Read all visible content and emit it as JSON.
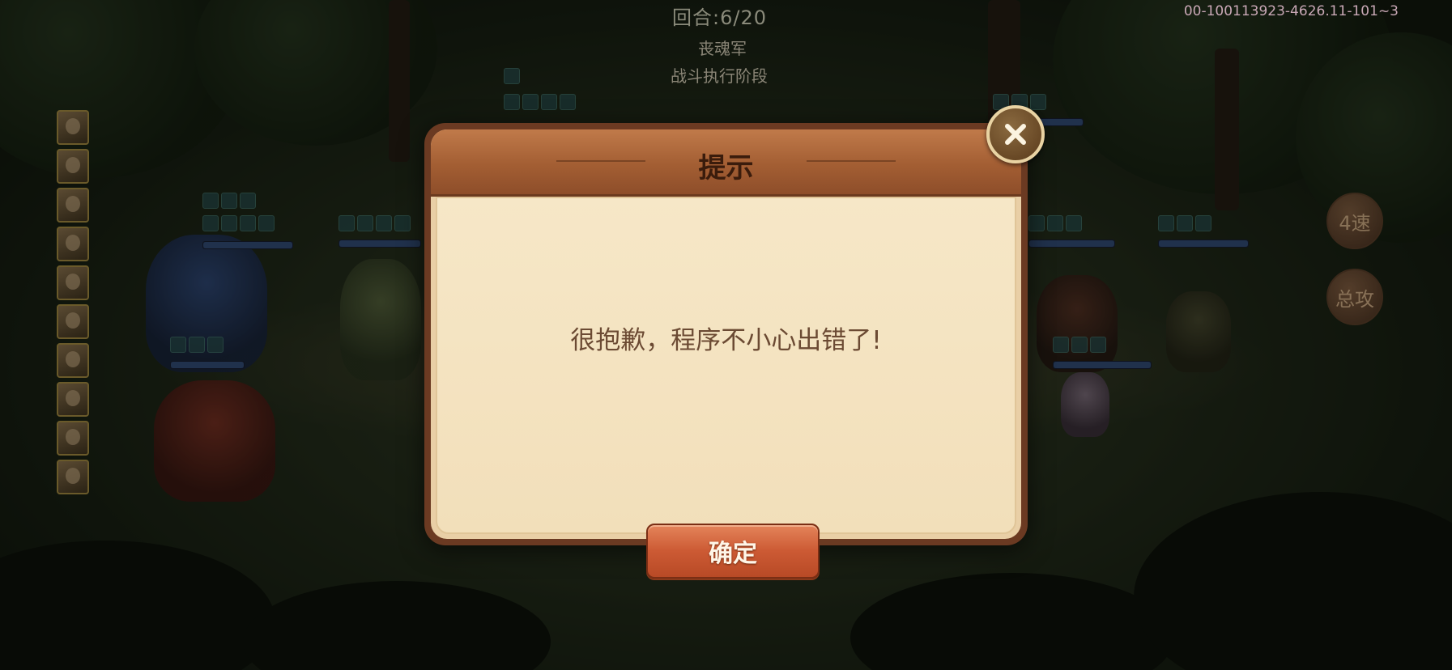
{
  "hud": {
    "round": "回合:6/20",
    "enemy_name": "丧魂军",
    "phase": "战斗执行阶段",
    "build_id": "00-100113923-4626.11-101~3"
  },
  "side_buttons": {
    "speed_label": "4速",
    "all_attack_label": "总攻"
  },
  "dialog": {
    "title": "提示",
    "message": "很抱歉，程序不小心出错了!",
    "confirm_label": "确定"
  },
  "portraits": [
    "hero-1",
    "hero-2",
    "hero-3",
    "hero-4",
    "hero-5",
    "hero-6",
    "hero-7",
    "hero-8",
    "hero-9",
    "hero-10"
  ]
}
